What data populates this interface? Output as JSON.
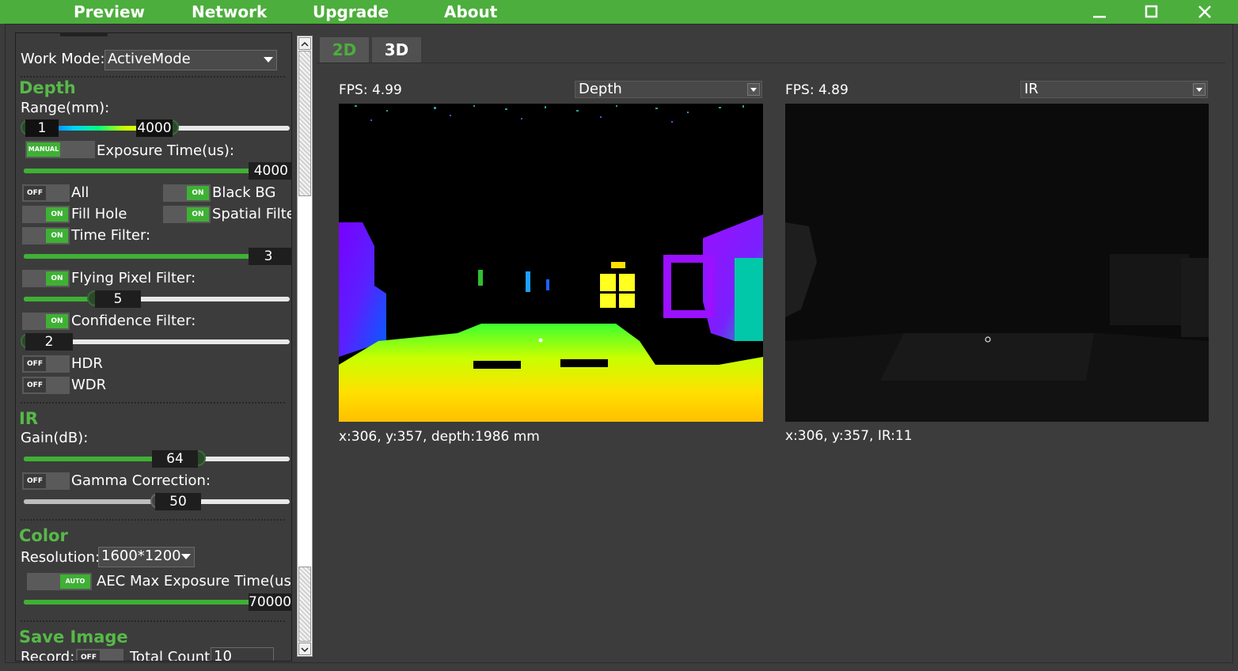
{
  "menu": {
    "preview": "Preview",
    "network": "Network",
    "upgrade": "Upgrade",
    "about": "About"
  },
  "window": {
    "minimize": "—",
    "maximize": "☐",
    "close": "✕"
  },
  "colors": {
    "accent": "#4cae3c",
    "panel": "#3c3c3c",
    "on": "#3eb134"
  },
  "left": {
    "work_mode_label": "Work Mode:",
    "work_mode_value": "ActiveMode",
    "depth": {
      "heading": "Depth",
      "range_label": "Range(mm):",
      "range_min": "1",
      "range_max": "4000",
      "exposure_toggle": "MANUAL",
      "exposure_label": "Exposure Time(us):",
      "exposure_value": "4000",
      "exposure_level": 0.85,
      "all_toggle": "OFF",
      "all_label": "All",
      "black_bg_toggle": "ON",
      "black_bg_label": "Black BG",
      "fill_hole_toggle": "ON",
      "fill_hole_label": "Fill Hole",
      "spatial_toggle": "ON",
      "spatial_label": "Spatial Filter",
      "time_filter_toggle": "ON",
      "time_filter_label": "Time Filter:",
      "time_filter_value": "3",
      "time_filter_level": 1.0,
      "flying_toggle": "ON",
      "flying_label": "Flying Pixel Filter:",
      "flying_value": "5",
      "flying_level": 0.27,
      "confidence_toggle": "ON",
      "confidence_label": "Confidence Filter:",
      "confidence_value": "2",
      "confidence_level": 0.02,
      "hdr_toggle": "OFF",
      "hdr_label": "HDR",
      "wdr_toggle": "OFF",
      "wdr_label": "WDR"
    },
    "ir": {
      "heading": "IR",
      "gain_label": "Gain(dB):",
      "gain_value": "64",
      "gain_level": 0.65,
      "gamma_toggle": "OFF",
      "gamma_label": "Gamma Correction:",
      "gamma_value": "50",
      "gamma_level": 0.5
    },
    "color": {
      "heading": "Color",
      "resolution_label": "Resolution:",
      "resolution_value": "1600*1200",
      "aec_toggle": "AUTO",
      "aec_label": "AEC Max Exposure Time(us):",
      "aec_value": "70000",
      "aec_level": 0.85
    },
    "save": {
      "heading": "Save Image",
      "record_label": "Record:",
      "record_toggle": "OFF",
      "total_label": "Total Count:",
      "total_value": "10"
    }
  },
  "tabs": {
    "tab_2d": "2D",
    "tab_3d": "3D"
  },
  "views": {
    "left_fps": "FPS: 4.99",
    "left_mode": "Depth",
    "left_info": "x:306, y:357, depth:1986 mm",
    "right_fps": "FPS: 4.89",
    "right_mode": "IR",
    "right_info": "x:306, y:357, IR:11"
  }
}
